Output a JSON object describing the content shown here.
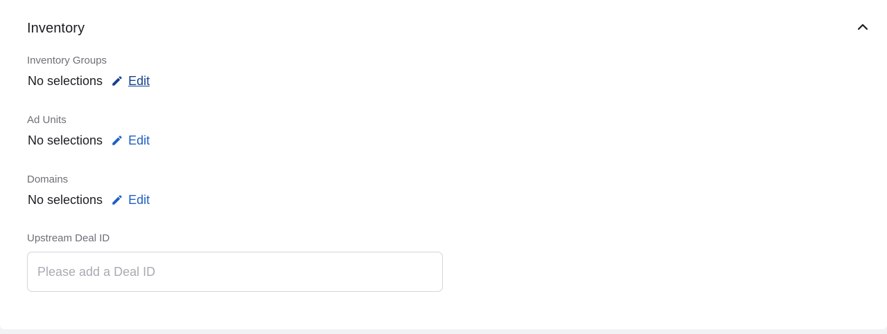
{
  "section": {
    "title": "Inventory"
  },
  "fields": [
    {
      "label": "Inventory Groups",
      "value": "No selections",
      "edit_label": "Edit"
    },
    {
      "label": "Ad Units",
      "value": "No selections",
      "edit_label": "Edit"
    },
    {
      "label": "Domains",
      "value": "No selections",
      "edit_label": "Edit"
    }
  ],
  "deal": {
    "label": "Upstream Deal ID",
    "placeholder": "Please add a Deal ID",
    "value": ""
  },
  "icons": {
    "collapse": "chevron-up-icon",
    "edit": "pencil-icon"
  },
  "colors": {
    "link": "#1f5fc4",
    "link_active": "#15408f",
    "label": "#6e6e78",
    "text": "#1c1c22"
  }
}
